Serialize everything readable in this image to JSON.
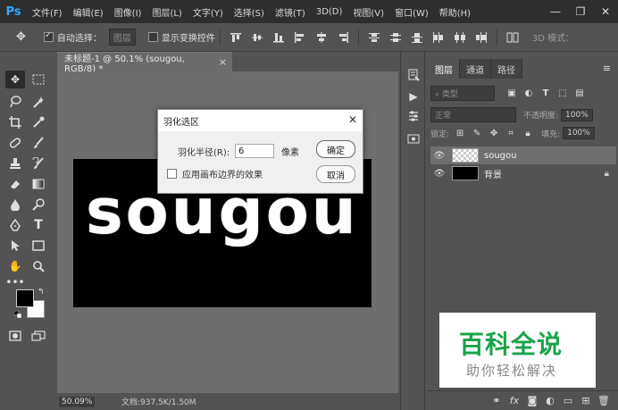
{
  "app": {
    "logo": "Ps"
  },
  "menubar": {
    "items": [
      "文件(F)",
      "编辑(E)",
      "图像(I)",
      "图层(L)",
      "文字(Y)",
      "选择(S)",
      "滤镜(T)",
      "3D(D)",
      "视图(V)",
      "窗口(W)",
      "帮助(H)"
    ],
    "minimize": "—",
    "restore": "❐",
    "close": "✕"
  },
  "options": {
    "auto_select_label": "自动选择：",
    "auto_select_value": "图层",
    "show_transform_label": "显示变换控件",
    "mode_label": "3D 模式："
  },
  "document": {
    "tab_title": "未标题-1 @ 50.1% (sougou, RGB/8) *",
    "tab_close": "×",
    "image_text": "sougou",
    "zoom": "50.09%",
    "doc_info": "文档:937.5K/1.50M"
  },
  "layers_panel": {
    "tabs": [
      "图层",
      "通道",
      "路径"
    ],
    "kind_filter": "类型",
    "blend_mode": "正常",
    "opacity_label": "不透明度:",
    "opacity_value": "100%",
    "lock_label": "锁定:",
    "fill_label": "填充:",
    "fill_value": "100%",
    "layers": [
      {
        "name": "sougou",
        "selected": true,
        "locked": false
      },
      {
        "name": "背景",
        "selected": false,
        "locked": true
      }
    ]
  },
  "dialog": {
    "title": "羽化选区",
    "close": "✕",
    "radius_label": "羽化半径(R):",
    "radius_value": "6",
    "radius_unit": "像素",
    "edge_checkbox_label": "应用画布边界的效果",
    "ok_label": "确定",
    "cancel_label": "取消"
  },
  "watermark": {
    "logo_text": "百科全说",
    "subtitle": "助你轻松解决"
  },
  "colors": {
    "foreground": "#000000",
    "background": "#ffffff",
    "ps_blue": "#31a8ff",
    "watermark_green": "#1aa34a"
  }
}
